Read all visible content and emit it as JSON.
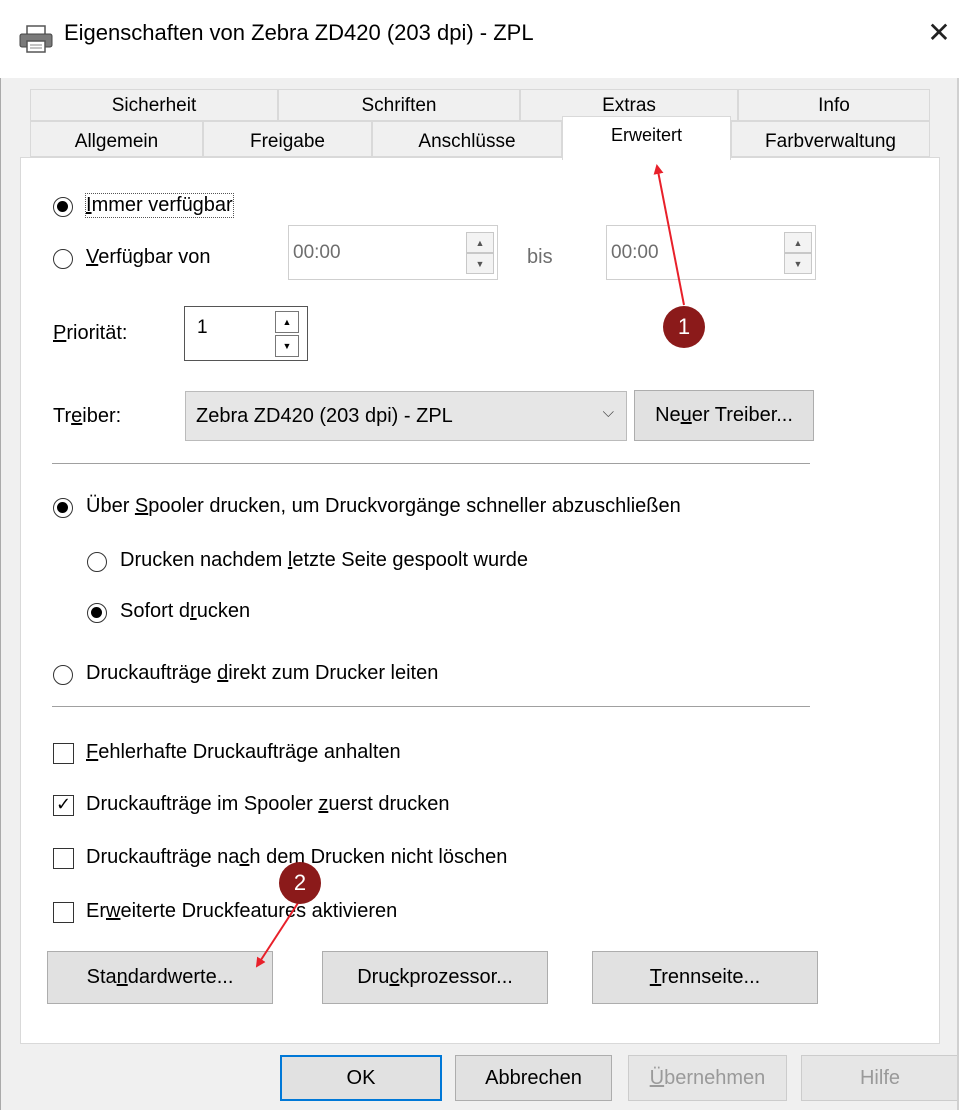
{
  "window": {
    "title": "Eigenschaften von Zebra ZD420 (203 dpi) - ZPL",
    "close_glyph": "✕",
    "icon": "printer-icon"
  },
  "tabs": {
    "row_top": [
      "Sicherheit",
      "Schriften",
      "Extras",
      "Info"
    ],
    "row_bottom": [
      "Allgemein",
      "Freigabe",
      "Anschlüsse",
      "Erweitert",
      "Farbverwaltung"
    ],
    "active": "Erweitert"
  },
  "availability": {
    "always_label": "Immer verfügbar",
    "always_u": "I",
    "always_rest": "mmer verfügbar",
    "from_u": "V",
    "from_rest": "erfügbar von",
    "from_time": "00:00",
    "bis_label": "bis",
    "to_time": "00:00",
    "selected": "always"
  },
  "priority": {
    "u": "P",
    "rest": "riorität:",
    "value": "1"
  },
  "driver": {
    "pre": "Tr",
    "u": "e",
    "post": "iber:",
    "value": "Zebra ZD420 (203 dpi) - ZPL",
    "new_pre": "Ne",
    "new_u": "u",
    "new_post": "er Treiber..."
  },
  "spooling": {
    "spool_pre": "Über ",
    "spool_u": "S",
    "spool_post": "pooler drucken, um Druckvorgänge schneller abzuschließen",
    "after_last_pre": "Drucken nachdem ",
    "after_last_u": "l",
    "after_last_post": "etzte Seite gespoolt wurde",
    "immediate_pre": "Sofort d",
    "immediate_u": "r",
    "immediate_post": "ucken",
    "direct_pre": "Druckaufträge ",
    "direct_u": "d",
    "direct_post": "irekt zum Drucker leiten"
  },
  "options": {
    "hold_u": "F",
    "hold_rest": "ehlerhafte Druckaufträge anhalten",
    "hold_checked": false,
    "spooled_first_pre": "Druckaufträge im Spooler ",
    "spooled_first_u": "z",
    "spooled_first_post": "uerst drucken",
    "spooled_first_checked": true,
    "keep_pre": "Druckaufträge na",
    "keep_u": "c",
    "keep_post": "h dem Drucken nicht löschen",
    "keep_checked": false,
    "advanced_pre": "Er",
    "advanced_u": "w",
    "advanced_post": "eiterte Druckfeatures aktivieren",
    "advanced_checked": false
  },
  "panel_buttons": {
    "defaults_pre": "Sta",
    "defaults_u": "n",
    "defaults_post": "dardwerte...",
    "processor_pre": "Dru",
    "processor_u": "c",
    "processor_post": "kprozessor...",
    "separator_u": "T",
    "separator_rest": "rennseite..."
  },
  "dialog_buttons": {
    "ok": "OK",
    "cancel": "Abbrechen",
    "apply_u": "Ü",
    "apply_rest": "bernehmen",
    "help": "Hilfe"
  },
  "annotations": [
    "1",
    "2"
  ],
  "colors": {
    "annotation_fill": "#8b1a1a",
    "arrow": "#e8202a",
    "default_button_border": "#0078d7"
  }
}
